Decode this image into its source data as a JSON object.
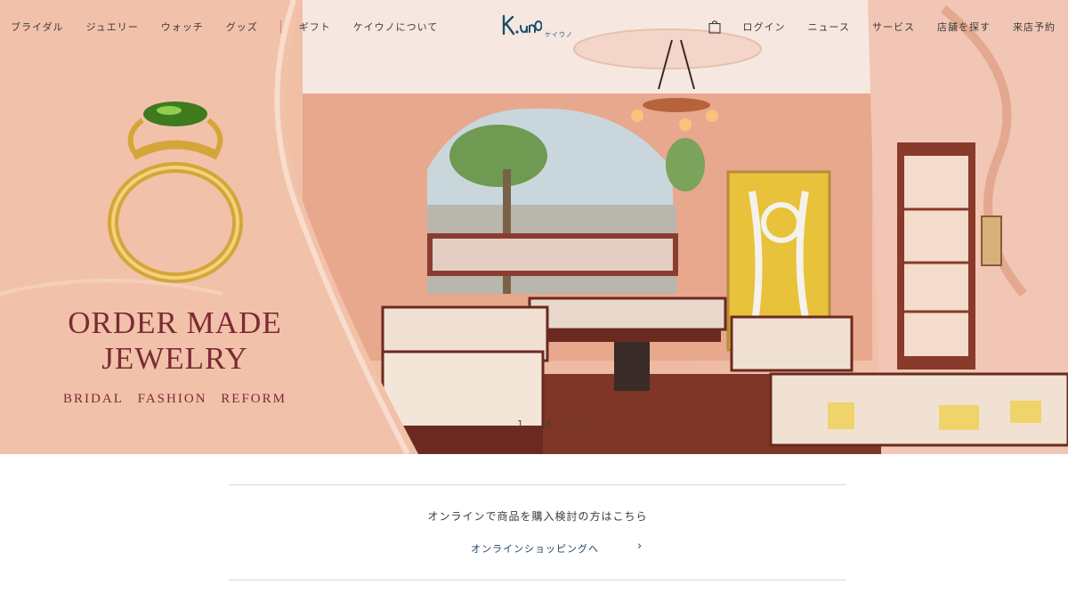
{
  "nav": {
    "left_items": [
      "ブライダル",
      "ジュエリー",
      "ウォッチ",
      "グッズ",
      "ギフト",
      "ケイウノについて"
    ],
    "right_items": [
      "ログイン",
      "ニュース",
      "サービス",
      "店舗を探す",
      "来店予約"
    ],
    "cart_icon": "shopping-bag-icon"
  },
  "logo": {
    "text": "K.uno",
    "sub": "ケイウノ"
  },
  "hero": {
    "title_line1": "ORDER MADE",
    "title_line2": "JEWELRY",
    "sub_items": [
      "BRIDAL",
      "FASHION",
      "REFORM"
    ],
    "pager": {
      "pages": [
        "1",
        "4"
      ],
      "active": "4",
      "next": "›"
    }
  },
  "online": {
    "text": "オンラインで商品を購入検討の方はこちら",
    "link_label": "オンラインショッピングへ",
    "chevron": "›"
  },
  "colors": {
    "accent_title": "#7b2a35",
    "logo": "#1d4f66",
    "link": "#1f3d58",
    "hero_bg": "#f0bfa6"
  }
}
